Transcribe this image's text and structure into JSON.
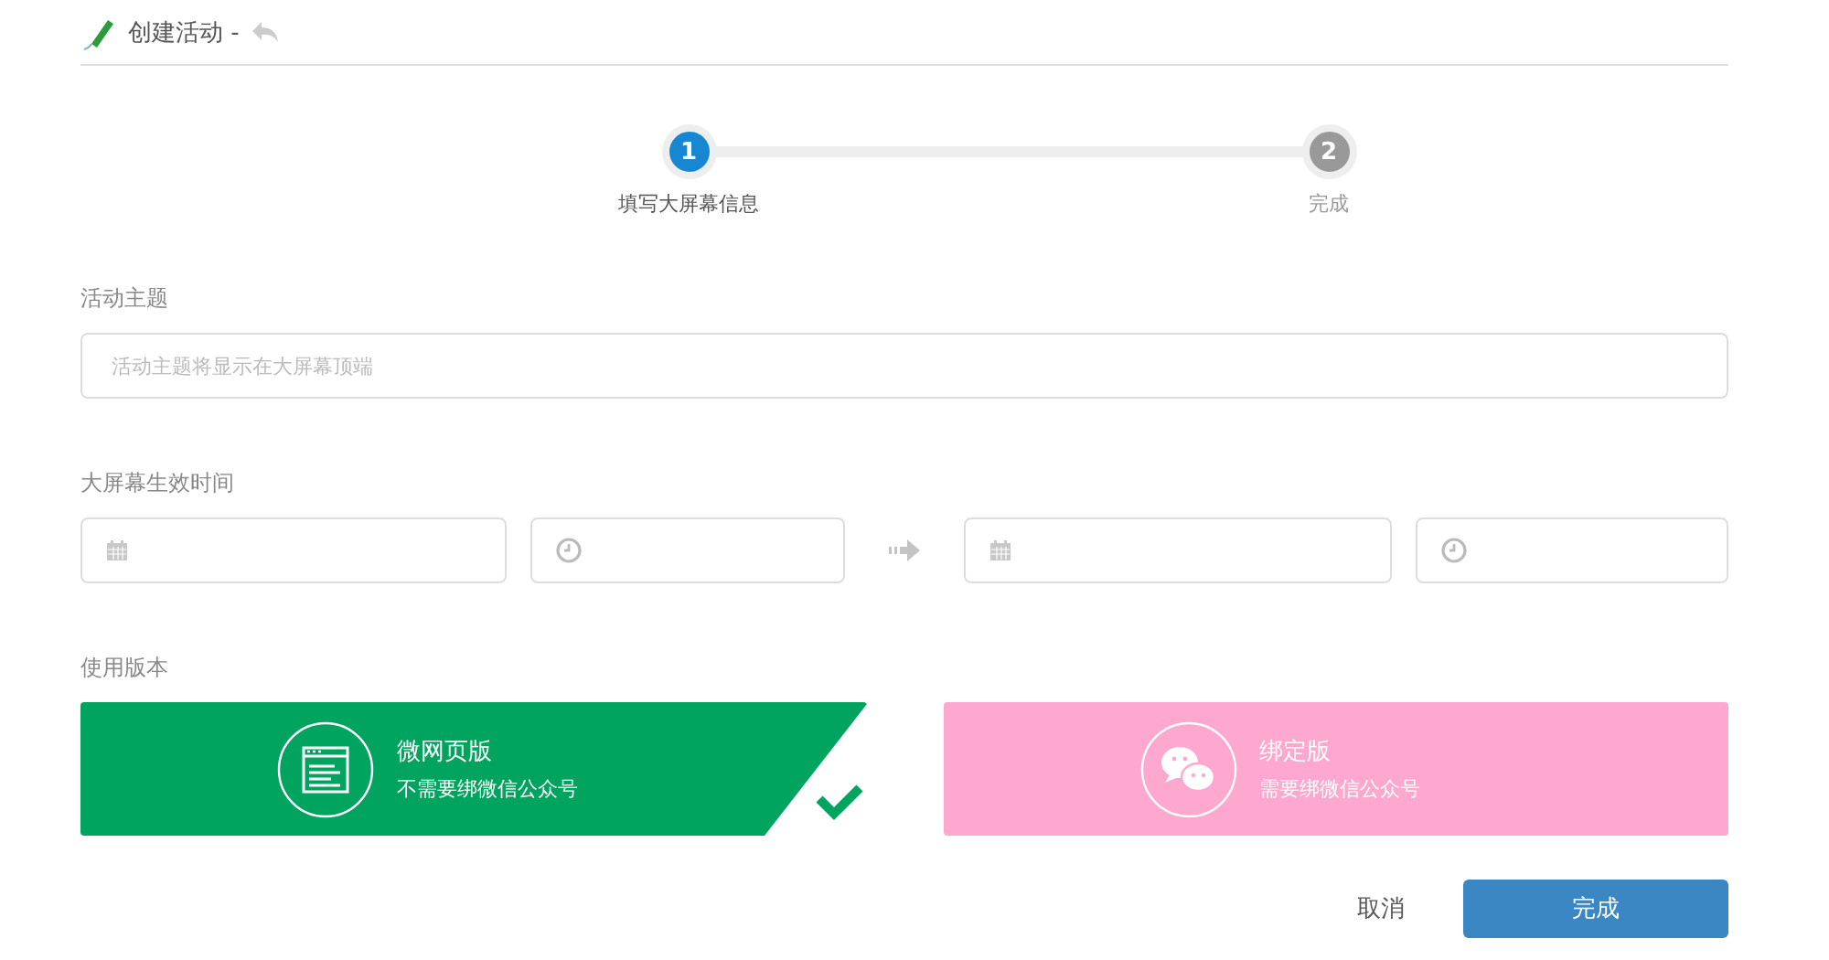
{
  "header": {
    "title": "创建活动 -"
  },
  "steps": [
    {
      "number": "1",
      "label": "填写大屏幕信息",
      "selected": true
    },
    {
      "number": "2",
      "label": "完成",
      "selected": false
    }
  ],
  "topic": {
    "label": "活动主题",
    "placeholder": "活动主题将显示在大屏幕顶端"
  },
  "time": {
    "label": "大屏幕生效时间",
    "fields": [
      {
        "kind": "date"
      },
      {
        "kind": "time"
      },
      {
        "kind": "arrow"
      },
      {
        "kind": "date"
      },
      {
        "kind": "time"
      }
    ]
  },
  "versions": {
    "label": "使用版本",
    "options": [
      {
        "kind": "web",
        "title": "微网页版",
        "subtitle": "不需要绑微信公众号",
        "color": "#00a45f",
        "selected": true
      },
      {
        "kind": "chat",
        "title": "绑定版",
        "subtitle": "需要绑微信公众号",
        "color": "#ffa8cf",
        "selected": false
      }
    ]
  },
  "buttons": {
    "cancel": "取消",
    "submit": "完成"
  }
}
